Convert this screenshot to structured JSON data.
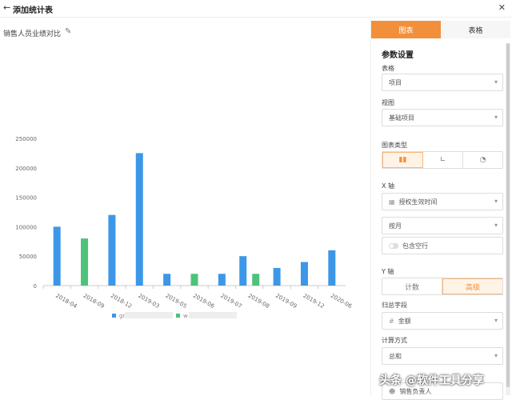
{
  "header": {
    "back_icon": "arrow-left-icon",
    "title": "添加统计表",
    "close_icon": "close-icon"
  },
  "chart_title": "销售人员业绩对比",
  "chart_data": {
    "type": "bar",
    "categories": [
      "2018-04",
      "2018-09",
      "2018-12",
      "2019-03",
      "2019-05",
      "2019-06",
      "2019-07",
      "2019-08",
      "2019-09",
      "2019-12",
      "2020-06"
    ],
    "series": [
      {
        "name": "gr",
        "color": "#3d97e8",
        "values": [
          100000,
          0,
          120000,
          225000,
          20000,
          0,
          20000,
          50000,
          30000,
          40000,
          60000
        ]
      },
      {
        "name": "w",
        "color": "#4dc27a",
        "values": [
          0,
          80000,
          0,
          0,
          0,
          20000,
          0,
          20000,
          0,
          0,
          0
        ]
      }
    ],
    "yticks": [
      "0",
      "50000",
      "100000",
      "150000",
      "200000",
      "250000"
    ],
    "ylim": [
      0,
      250000
    ]
  },
  "panel": {
    "tabs": {
      "chart": "图表",
      "table": "表格"
    },
    "section_title": "参数设置",
    "table_label": "表格",
    "table_value": "项目",
    "view_label": "视图",
    "view_value": "基础项目",
    "chart_type_label": "图表类型",
    "chart_type_icons": [
      "bar-chart-icon",
      "line-chart-icon",
      "pie-chart-icon"
    ],
    "x_axis_label": "X 轴",
    "x_field": "授权生效时间",
    "x_group": "按月",
    "include_empty": "包含空行",
    "y_axis_label": "Y 轴",
    "y_mode_count": "计数",
    "y_mode_advanced": "高级",
    "agg_field_label": "归总字段",
    "agg_field_value": "金额",
    "calc_label": "计算方式",
    "calc_value": "总和",
    "group_value": "销售负责人"
  },
  "watermark": "头条 @软件工具分享",
  "colors": {
    "accent": "#f28f3b",
    "bar_blue": "#3d97e8",
    "bar_green": "#4dc27a"
  }
}
